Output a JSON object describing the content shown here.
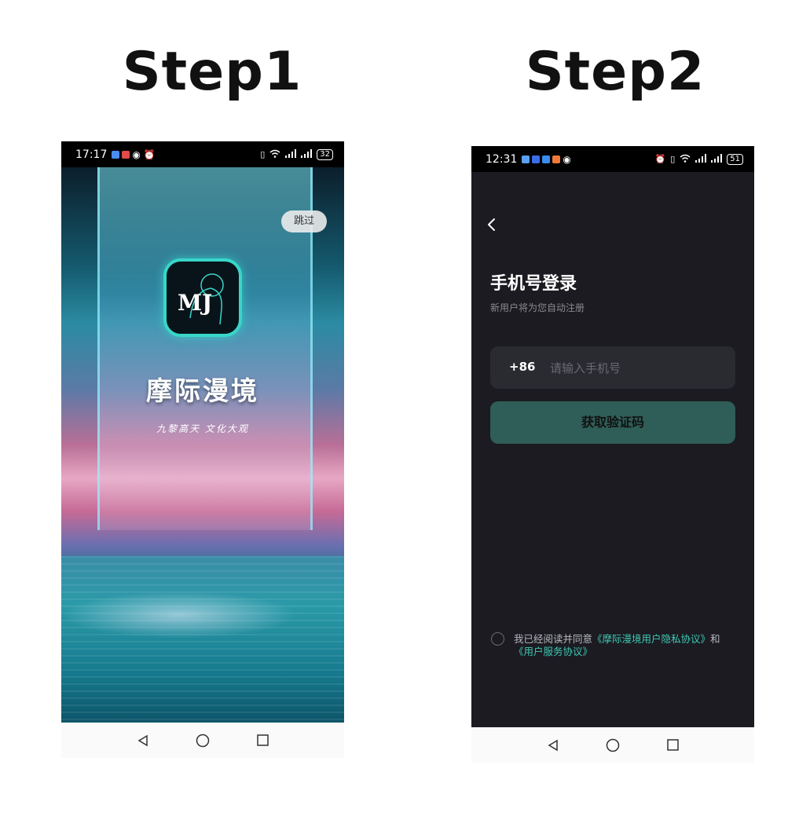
{
  "steps": {
    "step1": "Step1",
    "step2": "Step2"
  },
  "phone1": {
    "status": {
      "time": "17:17",
      "battery": "32"
    },
    "skip_label": "跳过",
    "app_name": "摩际漫境",
    "slogan": "九黎高天 文化大观",
    "logo_letters": "MJ"
  },
  "phone2": {
    "status": {
      "time": "12:31",
      "battery": "51"
    },
    "title": "手机号登录",
    "subtitle": "新用户将为您自动注册",
    "country_code": "+86",
    "phone_placeholder": "请输入手机号",
    "get_code_label": "获取验证码",
    "agreement": {
      "prefix": "我已经阅读并同意",
      "privacy_link": "《摩际漫境用户隐私协议》",
      "joiner": "和",
      "service_link": "《用户服务协议》"
    }
  },
  "colors": {
    "accent": "#40c8b4",
    "button_bg": "#2f5d57",
    "login_bg": "#1b1b21"
  },
  "icons": [
    "back-icon",
    "nav-back-icon",
    "nav-home-icon",
    "nav-recents-icon",
    "wifi-icon",
    "signal-icon",
    "battery-icon"
  ]
}
